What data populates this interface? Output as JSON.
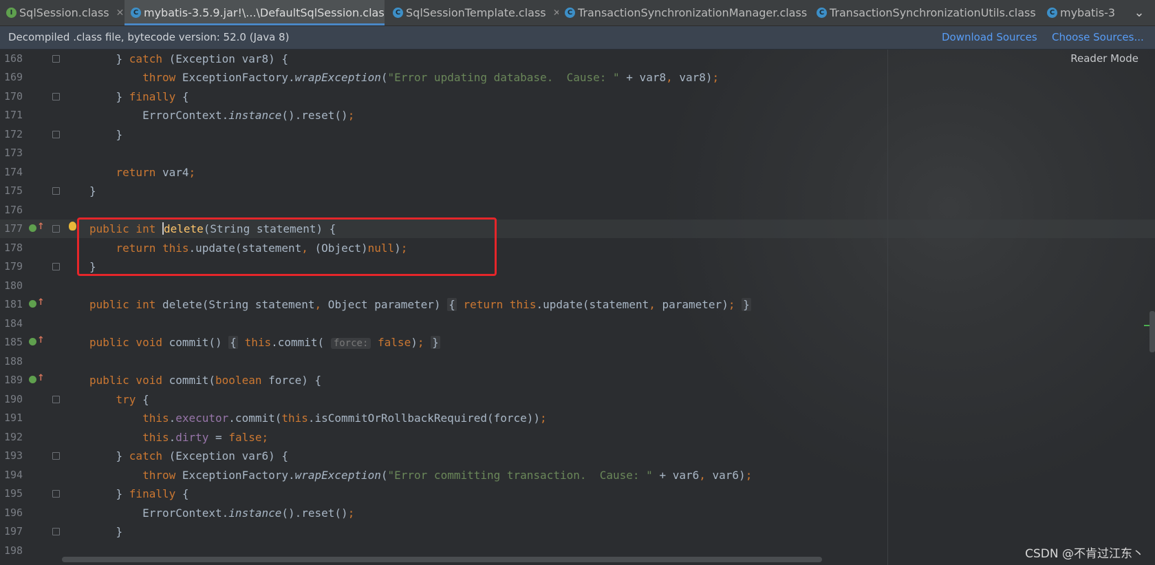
{
  "tabs": [
    {
      "label": "SqlSession.class",
      "icon": "interface-icon",
      "active": false
    },
    {
      "label": "mybatis-3.5.9.jar!\\...\\DefaultSqlSession.class",
      "icon": "class-icon",
      "active": true
    },
    {
      "label": "SqlSessionTemplate.class",
      "icon": "class-icon",
      "active": false
    },
    {
      "label": "TransactionSynchronizationManager.class",
      "icon": "class-icon",
      "active": false
    },
    {
      "label": "TransactionSynchronizationUtils.class",
      "icon": "class-icon",
      "active": false
    },
    {
      "label": "mybatis-3",
      "icon": "class-icon",
      "active": false
    }
  ],
  "banner": {
    "info": "Decompiled .class file, bytecode version: 52.0 (Java 8)",
    "download_sources": "Download Sources",
    "choose_sources": "Choose Sources..."
  },
  "editor": {
    "reader_mode": "Reader Mode",
    "line_numbers": [
      "168",
      "169",
      "170",
      "171",
      "172",
      "173",
      "174",
      "175",
      "176",
      "177",
      "178",
      "179",
      "180",
      "181",
      "184",
      "185",
      "188",
      "189",
      "190",
      "191",
      "192",
      "193",
      "194",
      "195",
      "196",
      "197",
      "198"
    ],
    "strings": {
      "s169": "\"Error updating database.  Cause: \"",
      "s194": "\"Error committing transaction.  Cause: \""
    },
    "hints": {
      "force": "force:"
    }
  },
  "watermark": "CSDN @不肯过江东丶",
  "colors": {
    "keyword": "#cc7832",
    "string": "#6a8759",
    "field": "#9876aa",
    "highlight_border": "#e5262a",
    "link": "#589df6"
  }
}
